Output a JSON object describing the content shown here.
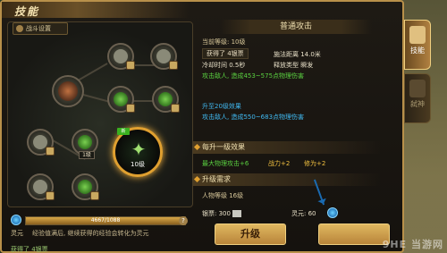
{
  "window": {
    "title": "技能"
  },
  "tree": {
    "battle_settings": "战斗设置",
    "nodes": [
      {
        "lvl": ""
      },
      {
        "lvl": ""
      },
      {
        "lvl": ""
      },
      {
        "lvl": ""
      },
      {
        "lvl": ""
      },
      {
        "lvl": ""
      },
      {
        "lvl": "1级"
      },
      {
        "lvl": ""
      },
      {
        "lvl": ""
      }
    ],
    "selected": {
      "badge": "新",
      "level": "10级"
    }
  },
  "exp": {
    "label": "灵元",
    "text": "4667/1088",
    "progress": 1.0,
    "hint": "经验值满后, 继续获得的经验会转化为灵元",
    "help": "?"
  },
  "bottom_msg": "获得了 4银票",
  "detail": {
    "header": "普通攻击",
    "current_level": "当前等级: 10级",
    "toast": "获得了 4银票",
    "cast_distance": "施法距离 14.0米",
    "cooldown": "冷却时间 0.5秒",
    "release_type": "释放类型 瞬发",
    "effect": "攻击敌人, 造成453~575点物理伤害",
    "next_title": "升至20级效果",
    "next_effect": "攻击敌人, 造成550~683点物理伤害",
    "per_level_title": "每升一级效果",
    "per_level_a": "最大物理攻击+6",
    "per_level_b": "战力+2",
    "per_level_c": "修为+2",
    "req_title": "升级需求",
    "req_level": "人物等级 16级",
    "silver_label": "银票: 300",
    "spirit_label": "灵元: 60",
    "upgrade": "升级"
  },
  "tabs": [
    {
      "label": "技能",
      "active": true
    },
    {
      "label": "弑神",
      "active": false
    }
  ],
  "watermark": "9HE 当游网"
}
